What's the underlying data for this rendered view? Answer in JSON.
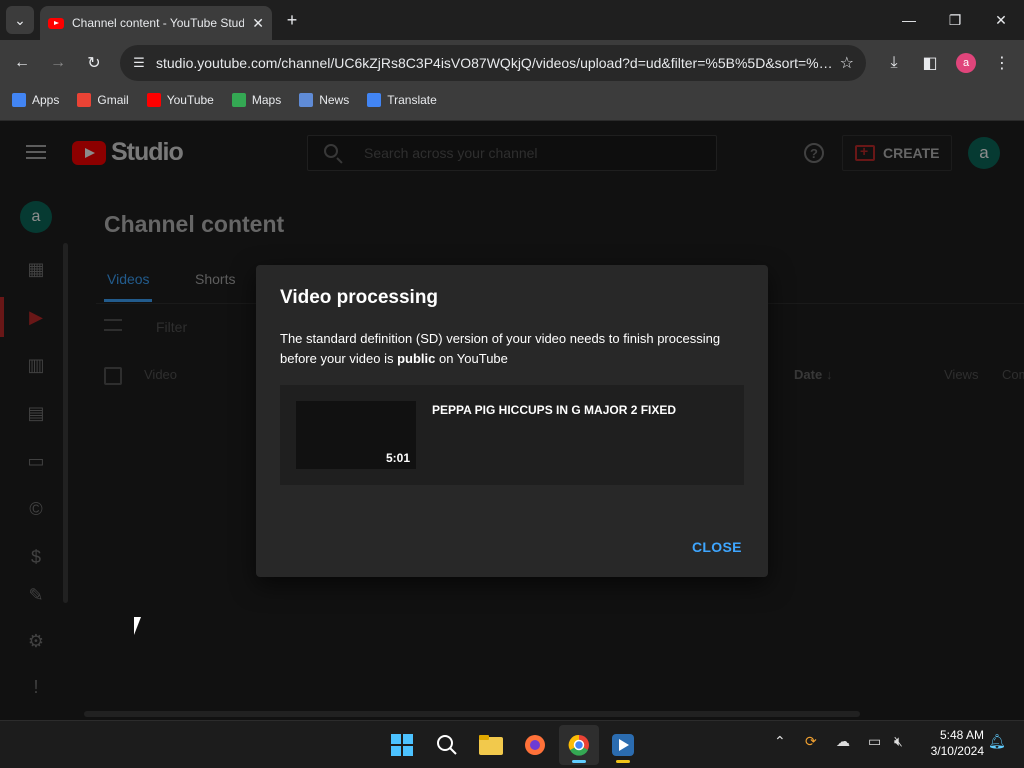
{
  "browser": {
    "tab_title": "Channel content - YouTube Studio",
    "url": "studio.youtube.com/channel/UC6kZjRs8C3P4isVO87WQkjQ/videos/upload?d=ud&filter=%5B%5D&sort=%…",
    "profile_initial": "a",
    "bookmarks": [
      {
        "label": "Apps",
        "color": "#4285f4"
      },
      {
        "label": "Gmail",
        "color": "#ea4335"
      },
      {
        "label": "YouTube",
        "color": "#ff0000"
      },
      {
        "label": "Maps",
        "color": "#34a853"
      },
      {
        "label": "News",
        "color": "#5f8bd6"
      },
      {
        "label": "Translate",
        "color": "#4285f4"
      }
    ]
  },
  "studio": {
    "logo_text": "Studio",
    "search_placeholder": "Search across your channel",
    "create_label": "CREATE",
    "avatar_initial": "a",
    "page_title": "Channel content",
    "tabs": [
      "Videos",
      "Shorts"
    ],
    "filter_label": "Filter",
    "columns": {
      "video": "Video",
      "date": "Date",
      "views": "Views",
      "comments": "Com"
    }
  },
  "dialog": {
    "title": "Video processing",
    "message_pre": "The standard definition (SD) version of your video needs to finish processing before your video is ",
    "message_bold": "public",
    "message_post": " on YouTube",
    "video_title": "PEPPA PIG HICCUPS IN G MAJOR 2 FIXED",
    "video_duration": "5:01",
    "close_label": "CLOSE"
  },
  "taskbar": {
    "time": "5:48 AM",
    "date": "3/10/2024"
  },
  "colors": {
    "accent_blue": "#3ea6ff",
    "youtube_red": "#ff0000",
    "avatar_green": "#0b6b5c"
  }
}
